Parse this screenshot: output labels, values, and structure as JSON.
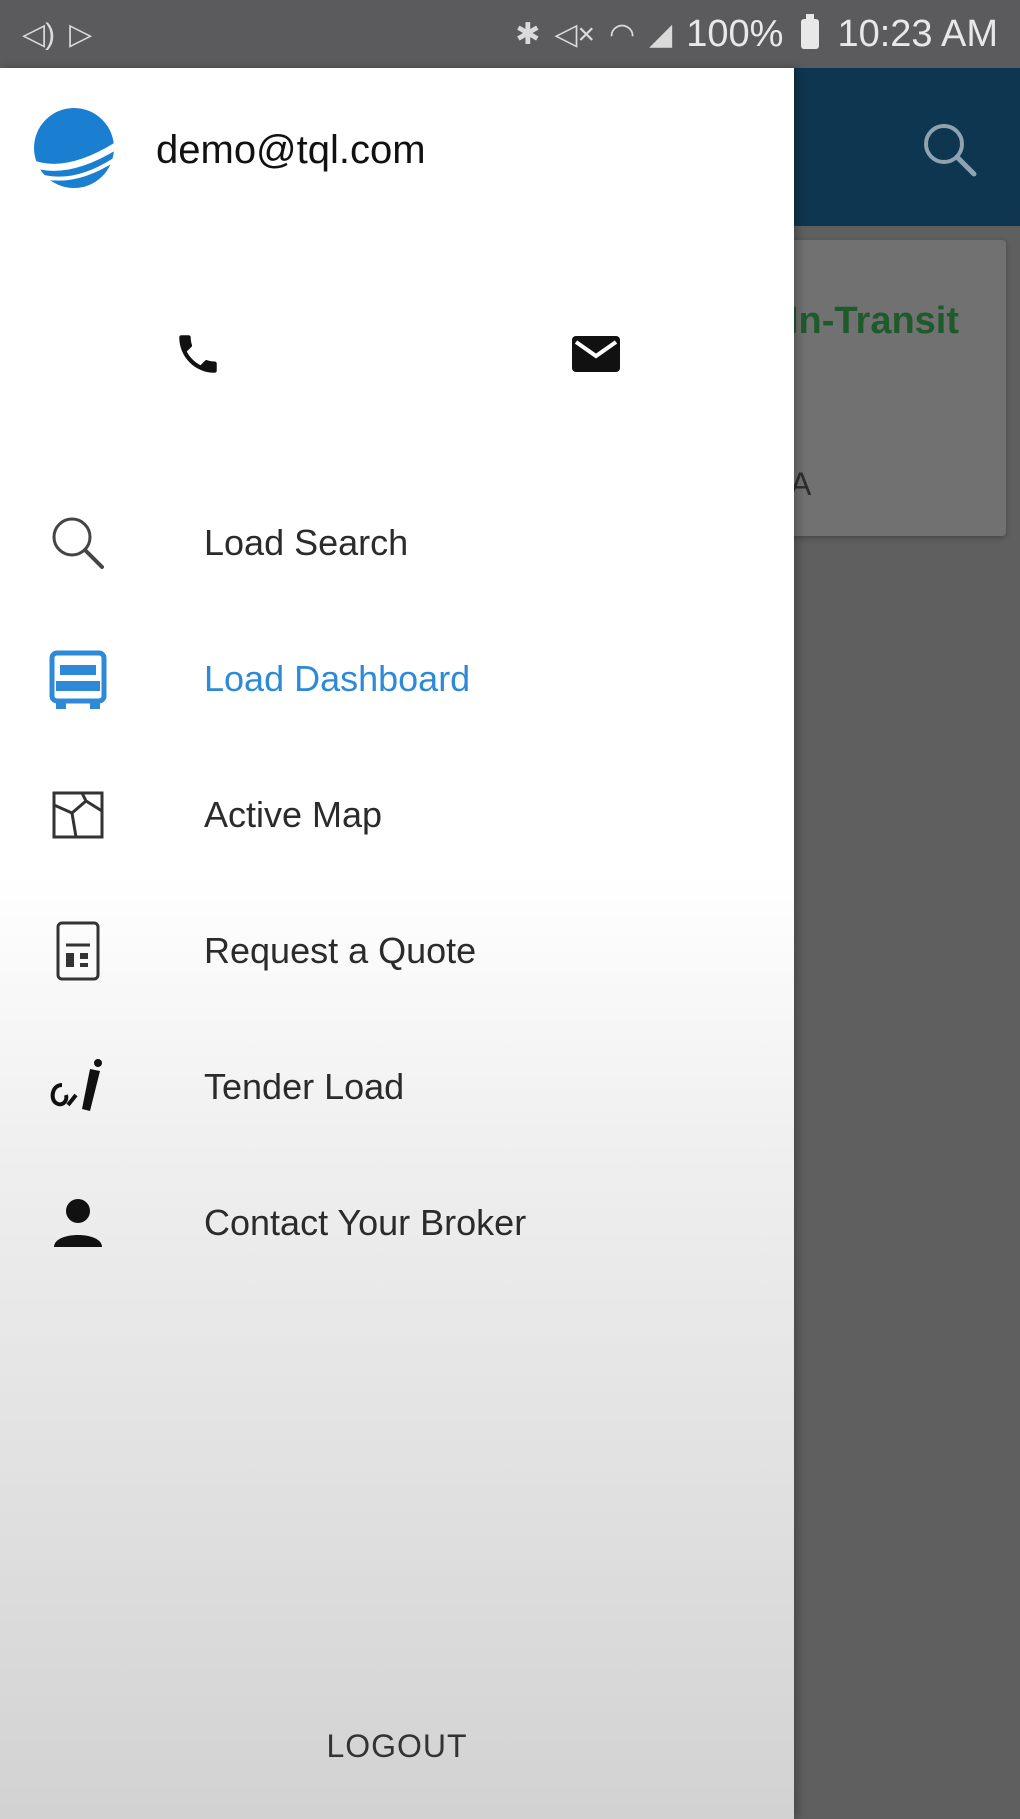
{
  "status_bar": {
    "battery": "100%",
    "time": "10:23 AM"
  },
  "background": {
    "card_status": "In-Transit",
    "card_fragment": "A",
    "colors": {
      "toolbar": "#0f3650",
      "status_text": "#1f5a2d"
    }
  },
  "drawer": {
    "user_email": "demo@tql.com",
    "menu": [
      {
        "label": "Load Search",
        "icon": "search-icon",
        "active": false
      },
      {
        "label": "Load Dashboard",
        "icon": "dashboard-icon",
        "active": true
      },
      {
        "label": "Active Map",
        "icon": "map-icon",
        "active": false
      },
      {
        "label": "Request a Quote",
        "icon": "quote-document-icon",
        "active": false
      },
      {
        "label": "Tender Load",
        "icon": "tender-icon",
        "active": false
      },
      {
        "label": "Contact Your Broker",
        "icon": "person-icon",
        "active": false
      }
    ],
    "logout_label": "LOGOUT",
    "colors": {
      "active": "#2e8ad6",
      "logo": "#1a7fd0"
    }
  }
}
